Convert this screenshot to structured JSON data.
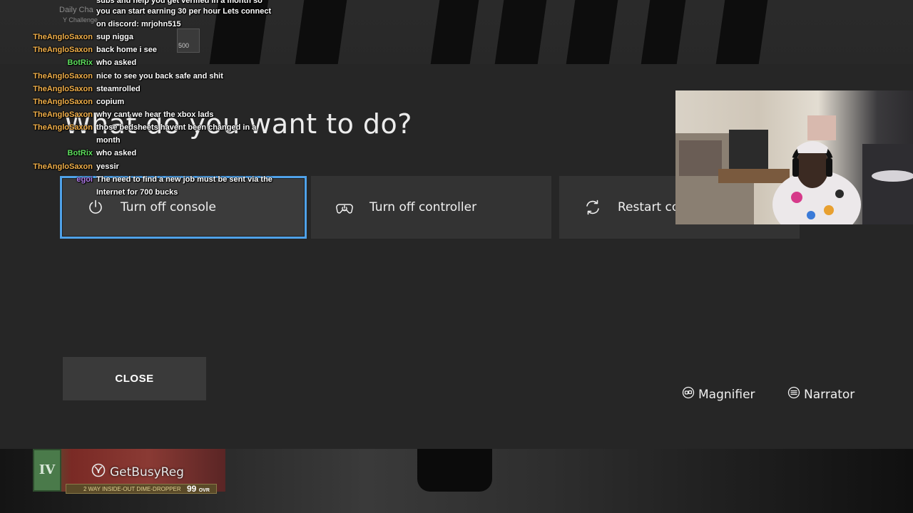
{
  "guide": {
    "title": "What do you want to do?",
    "actions": [
      {
        "label": "Turn off console",
        "icon": "power-icon"
      },
      {
        "label": "Turn off controller",
        "icon": "controller-power-icon"
      },
      {
        "label": "Restart co",
        "icon": "restart-icon"
      }
    ],
    "close_label": "CLOSE",
    "accessibility": [
      {
        "label": "Magnifier",
        "icon": "magnifier-icon"
      },
      {
        "label": "Narrator",
        "icon": "narrator-icon"
      }
    ],
    "focus_color": "#4fa1e8"
  },
  "stream": {
    "daily_title": "Daily Cha",
    "daily_sub": "Y Challenge",
    "coin_count": "500",
    "gamertag": "GetBusyReg",
    "card_ovr_badge": "IV",
    "card_name": "2 WAY INSIDE-OUT DIME-DROPPER",
    "card_rating": "99",
    "card_rating_suffix": "OVR"
  },
  "chat": [
    {
      "user": "",
      "text": "subs and help you get verified in a month so",
      "user_color": "anglo"
    },
    {
      "user": "",
      "text": "you can start earning 30 per hour Lets connect",
      "user_color": "anglo"
    },
    {
      "user": "",
      "text": "on discord: mrjohn515",
      "user_color": "anglo"
    },
    {
      "user": "TheAngloSaxon",
      "text": "sup nigga",
      "user_color": "anglo"
    },
    {
      "user": "TheAngloSaxon",
      "text": "back home i see",
      "user_color": "anglo"
    },
    {
      "user": "BotRix",
      "text": "who asked",
      "user_color": "botrix"
    },
    {
      "user": "TheAngloSaxon",
      "text": "nice to see you back safe and shit",
      "user_color": "anglo"
    },
    {
      "user": "TheAngloSaxon",
      "text": "steamrolled",
      "user_color": "anglo"
    },
    {
      "user": "TheAngloSaxon",
      "text": "copium",
      "user_color": "anglo"
    },
    {
      "user": "TheAngloSaxon",
      "text": "why cant we hear the xbox lads",
      "user_color": "anglo"
    },
    {
      "user": "TheAngloSaxon",
      "text": "those bedsheets havent been changed in a",
      "user_color": "anglo"
    },
    {
      "user": "",
      "text": "month",
      "user_color": "anglo"
    },
    {
      "user": "BotRix",
      "text": "who asked",
      "user_color": "botrix"
    },
    {
      "user": "TheAngloSaxon",
      "text": "yessir",
      "user_color": "anglo"
    },
    {
      "user": "egoi",
      "text": "The need to find a new job must be sent via the",
      "user_color": "egoi"
    },
    {
      "user": "",
      "text": "Internet for 700 bucks",
      "user_color": "egoi"
    }
  ]
}
